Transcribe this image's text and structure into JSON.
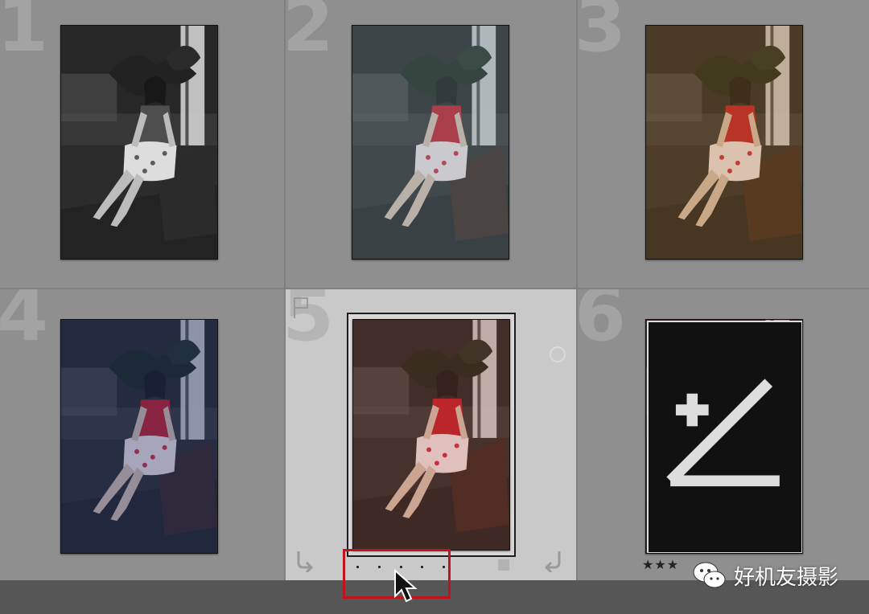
{
  "grid": {
    "cells": [
      {
        "number": "1",
        "tone": "monochrome"
      },
      {
        "number": "2",
        "tone": "faded-cool"
      },
      {
        "number": "3",
        "tone": "warm-sepia"
      },
      {
        "number": "4",
        "tone": "blue-shadows"
      },
      {
        "number": "5",
        "tone": "warm-vivid",
        "selected": true,
        "rating": 0,
        "rating_dots": 5
      },
      {
        "number": "6",
        "tone": "vivid-contrast",
        "rating": 3,
        "has_develop_adjustments": true
      }
    ]
  },
  "icons": {
    "flag": "flag-icon",
    "rotate_left": "rotate-left-icon",
    "rotate_right": "rotate-right-icon",
    "develop": "develop-adjustment-icon",
    "cursor": "mouse-pointer-icon",
    "wechat": "wechat-icon"
  },
  "cell6": {
    "stars": "★★★"
  },
  "watermark": {
    "text": "好机友摄影"
  },
  "colors": {
    "background": "#8f8f8f",
    "selected_cell": "#c9c9c9",
    "bottom_bar": "#565656",
    "highlight": "#c0141c"
  }
}
